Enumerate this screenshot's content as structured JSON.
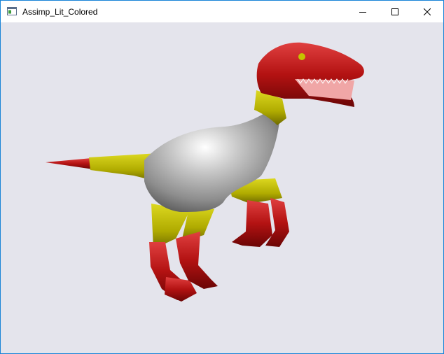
{
  "window": {
    "title": "Assimp_Lit_Colored",
    "controls": [
      "minimize",
      "maximize",
      "close"
    ]
  },
  "viewport": {
    "background": "#e4e4ec",
    "scene": {
      "model": "raptor",
      "colors": {
        "head_feet": "#b31212",
        "bands": "#b8b400",
        "body": "#c9c9c9"
      }
    }
  }
}
